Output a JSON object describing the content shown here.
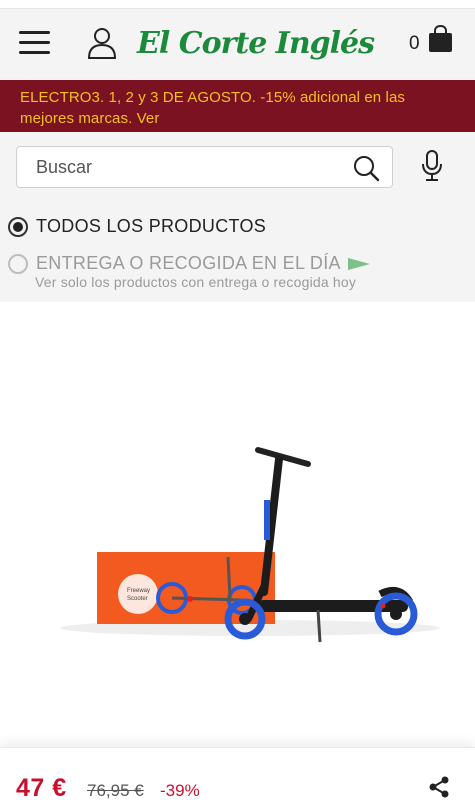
{
  "header": {
    "logo_text": "El Corte Inglés",
    "cart_count": "0",
    "icons": [
      "menu-icon",
      "user-icon",
      "shopping-bag-icon"
    ]
  },
  "promo": {
    "text": "ELECTRO3. 1, 2 y 3 DE AGOSTO. -15% adicional en las mejores marcas. Ver"
  },
  "search": {
    "placeholder": "Buscar",
    "icons": [
      "search-icon",
      "microphone-icon"
    ]
  },
  "filters": {
    "all_products": "TODOS LOS PRODUCTOS",
    "same_day": "ENTREGA O RECOGIDA EN EL DÍA",
    "same_day_note": "Ver solo los productos con entrega o recogida hoy",
    "selected": "all_products"
  },
  "product": {
    "image": "scooter-with-box",
    "box_text_1": "Freeway",
    "box_text_2": "Scooter",
    "price": "47 €",
    "old_price": "76,95 €",
    "discount": "-39%",
    "colors": {
      "price": "#c8102e",
      "box": "#f25a1f",
      "wheels": "#2a5bd7"
    }
  },
  "colors": {
    "brand_green": "#1b8a3a",
    "promo_bg": "#7b1222",
    "promo_text": "#f3c11e"
  }
}
